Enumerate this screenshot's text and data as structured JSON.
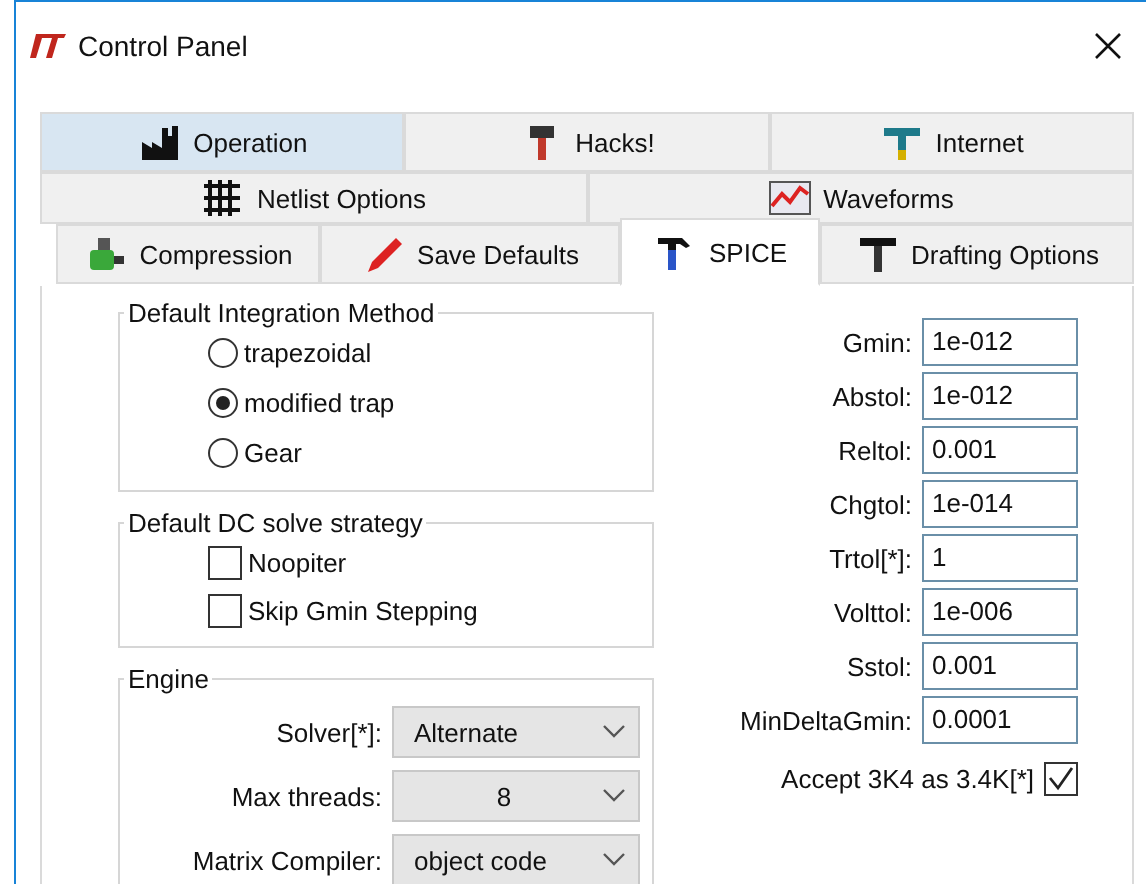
{
  "window": {
    "title": "Control Panel"
  },
  "tab_rows": [
    {
      "tabs": [
        {
          "label": "Operation",
          "selected": false,
          "highlighted": true
        },
        {
          "label": "Hacks!",
          "selected": false,
          "highlighted": false
        },
        {
          "label": "Internet",
          "selected": false,
          "highlighted": false
        }
      ]
    },
    {
      "tabs": [
        {
          "label": "Netlist Options",
          "selected": false,
          "highlighted": false
        },
        {
          "label": "Waveforms",
          "selected": false,
          "highlighted": false
        }
      ]
    },
    {
      "tabs": [
        {
          "label": "Compression",
          "selected": false,
          "highlighted": false
        },
        {
          "label": "Save Defaults",
          "selected": false,
          "highlighted": false
        },
        {
          "label": "SPICE",
          "selected": true,
          "highlighted": false
        },
        {
          "label": "Drafting Options",
          "selected": false,
          "highlighted": false
        }
      ]
    }
  ],
  "integration_method": {
    "title": "Default Integration Method",
    "options": [
      {
        "label": "trapezoidal",
        "selected": false
      },
      {
        "label": "modified trap",
        "selected": true
      },
      {
        "label": "Gear",
        "selected": false
      }
    ]
  },
  "dc_strategy": {
    "title": "Default DC solve strategy",
    "options": [
      {
        "label": "Noopiter",
        "checked": false
      },
      {
        "label": "Skip Gmin Stepping",
        "checked": false
      }
    ]
  },
  "engine": {
    "title": "Engine",
    "fields": [
      {
        "label": "Solver[*]:",
        "value": "Alternate",
        "kind": "text"
      },
      {
        "label": "Max threads:",
        "value": "8",
        "kind": "number"
      },
      {
        "label": "Matrix Compiler:",
        "value": "object code",
        "kind": "text"
      }
    ]
  },
  "tolerances": [
    {
      "label": "Gmin:",
      "value": "1e-012"
    },
    {
      "label": "Abstol:",
      "value": "1e-012"
    },
    {
      "label": "Reltol:",
      "value": "0.001"
    },
    {
      "label": "Chgtol:",
      "value": "1e-014"
    },
    {
      "label": "Trtol[*]:",
      "value": "1"
    },
    {
      "label": "Volttol:",
      "value": "1e-006"
    },
    {
      "label": "Sstol:",
      "value": "0.001"
    },
    {
      "label": "MinDeltaGmin:",
      "value": "0.0001"
    }
  ],
  "accept_3k4": {
    "label": "Accept 3K4 as 3.4K[*]",
    "checked": true
  }
}
